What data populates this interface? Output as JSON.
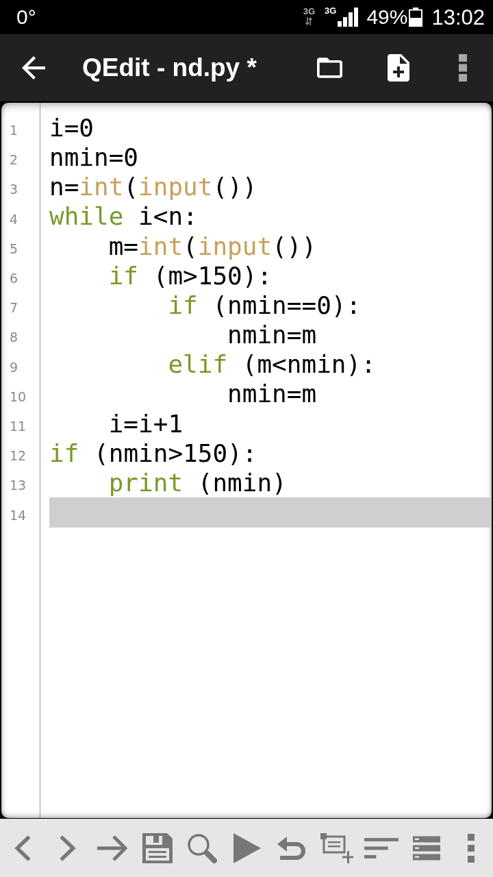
{
  "status_bar": {
    "temperature": "0°",
    "networks": [
      {
        "kind": "data",
        "label": "3G"
      },
      {
        "kind": "voice",
        "label": "3G"
      }
    ],
    "battery_percent": "49%",
    "time": "13:02"
  },
  "app_bar": {
    "title": "QEdit - nd.py *"
  },
  "editor": {
    "lines": [
      {
        "number": "1",
        "selected": false,
        "tokens": [
          {
            "kind": "plain",
            "text": "i=0"
          }
        ]
      },
      {
        "number": "2",
        "selected": false,
        "tokens": [
          {
            "kind": "plain",
            "text": "nmin=0"
          }
        ]
      },
      {
        "number": "3",
        "selected": false,
        "tokens": [
          {
            "kind": "plain",
            "text": "n="
          },
          {
            "kind": "builtin",
            "text": "int"
          },
          {
            "kind": "plain",
            "text": "("
          },
          {
            "kind": "builtin",
            "text": "input"
          },
          {
            "kind": "plain",
            "text": "())"
          }
        ]
      },
      {
        "number": "4",
        "selected": false,
        "tokens": [
          {
            "kind": "keyword",
            "text": "while"
          },
          {
            "kind": "plain",
            "text": " i<n:"
          }
        ],
        "children": [
          {
            "number": "5",
            "selected": false,
            "tokens": [
              {
                "kind": "plain",
                "text": "m="
              },
              {
                "kind": "builtin",
                "text": "int"
              },
              {
                "kind": "plain",
                "text": "("
              },
              {
                "kind": "builtin",
                "text": "input"
              },
              {
                "kind": "plain",
                "text": "())"
              }
            ]
          },
          {
            "number": "6",
            "selected": false,
            "tokens": [
              {
                "kind": "keyword",
                "text": "if"
              },
              {
                "kind": "plain",
                "text": " (m>150):"
              }
            ],
            "children": [
              {
                "number": "7",
                "selected": false,
                "tokens": [
                  {
                    "kind": "keyword",
                    "text": "if"
                  },
                  {
                    "kind": "plain",
                    "text": " (nmin==0):"
                  }
                ],
                "children": [
                  {
                    "number": "8",
                    "selected": false,
                    "tokens": [
                      {
                        "kind": "plain",
                        "text": "nmin=m"
                      }
                    ]
                  }
                ]
              },
              {
                "number": "9",
                "selected": false,
                "tokens": [
                  {
                    "kind": "keyword",
                    "text": "elif"
                  },
                  {
                    "kind": "plain",
                    "text": " (m<nmin):"
                  }
                ],
                "children": [
                  {
                    "number": "10",
                    "selected": false,
                    "tokens": [
                      {
                        "kind": "plain",
                        "text": "nmin=m"
                      }
                    ]
                  }
                ]
              }
            ]
          },
          {
            "number": "11",
            "selected": false,
            "tokens": [
              {
                "kind": "plain",
                "text": "i=i+1"
              }
            ]
          }
        ]
      },
      {
        "number": "12",
        "selected": false,
        "tokens": [
          {
            "kind": "keyword",
            "text": "if"
          },
          {
            "kind": "plain",
            "text": " (nmin>150):"
          }
        ],
        "children": [
          {
            "number": "13",
            "selected": false,
            "tokens": [
              {
                "kind": "keyword",
                "text": "print"
              },
              {
                "kind": "plain",
                "text": " (nmin)"
              }
            ]
          }
        ]
      },
      {
        "number": "14",
        "selected": true
      }
    ]
  }
}
